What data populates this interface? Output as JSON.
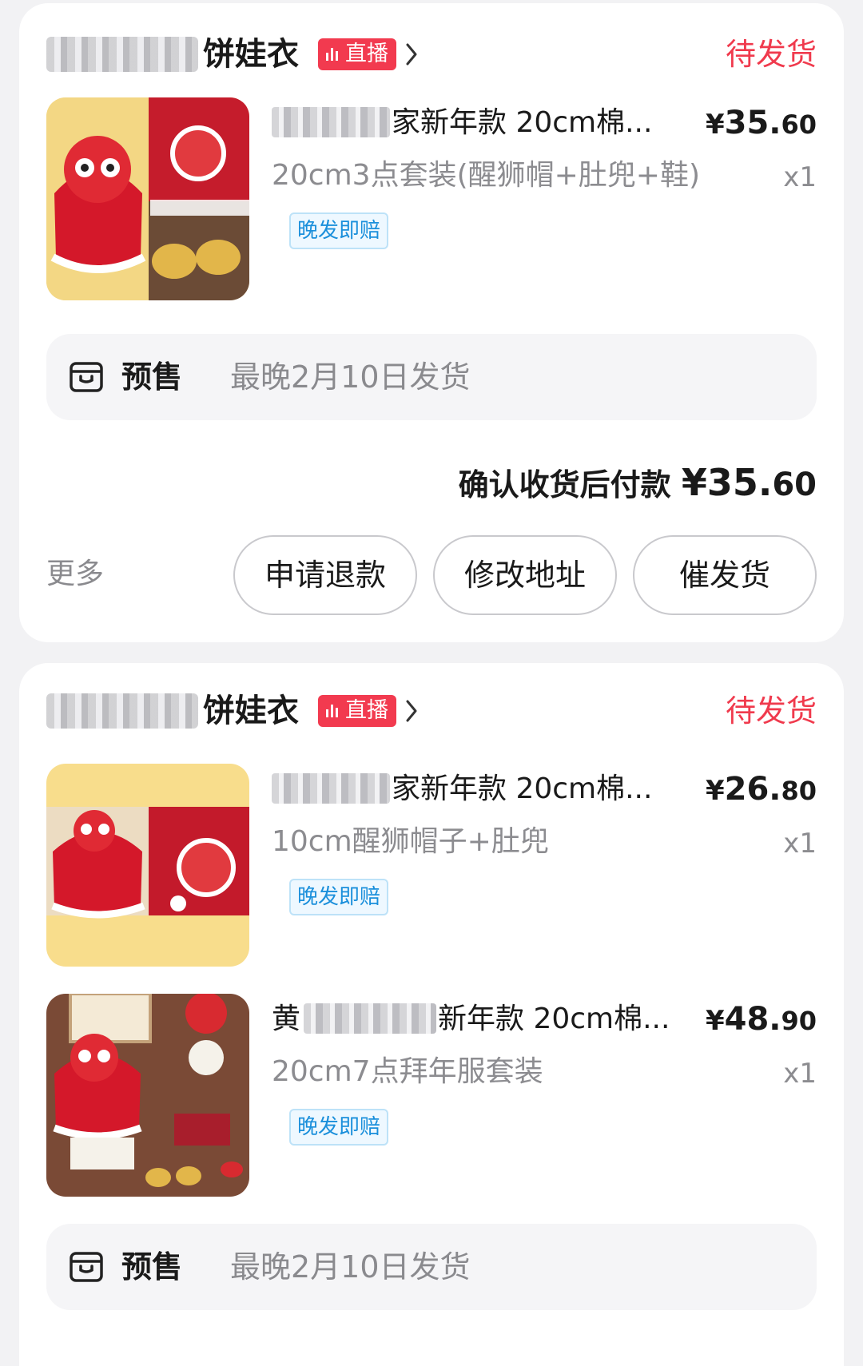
{
  "orders": [
    {
      "shop_name": "饼娃衣",
      "live_label": "直播",
      "status": "待发货",
      "items": [
        {
          "title": "家新年款 20cm棉...",
          "price_yen": "¥",
          "price_int": "35.",
          "price_dec": "60",
          "sku": "20cm3点套装(醒狮帽+肚兜+鞋)",
          "qty": "x1",
          "tag": "晚发即赔"
        }
      ],
      "presale_label": "预售",
      "presale_text": "最晚2月10日发货",
      "total_label": "确认收货后付款",
      "total_yen": "¥",
      "total_int": "35.",
      "total_dec": "60",
      "more_label": "更多",
      "buttons": [
        "申请退款",
        "修改地址",
        "催发货"
      ]
    },
    {
      "shop_name": "饼娃衣",
      "live_label": "直播",
      "status": "待发货",
      "items": [
        {
          "title": "家新年款 20cm棉...",
          "price_yen": "¥",
          "price_int": "26.",
          "price_dec": "80",
          "sku": "10cm醒狮帽子+肚兜",
          "qty": "x1",
          "tag": "晚发即赔"
        },
        {
          "title": "新年款 20cm棉...",
          "price_yen": "¥",
          "price_int": "48.",
          "price_dec": "90",
          "sku": "20cm7点拜年服套装",
          "qty": "x1",
          "tag": "晚发即赔"
        }
      ],
      "presale_label": "预售",
      "presale_text": "最晚2月10日发货"
    }
  ],
  "icons": [
    "live-bars-icon",
    "chevron-right-icon",
    "package-icon"
  ],
  "colors": {
    "status_red": "#f03a4d",
    "live_red": "#f23a4f",
    "tag_blue": "#1a8fdb"
  }
}
